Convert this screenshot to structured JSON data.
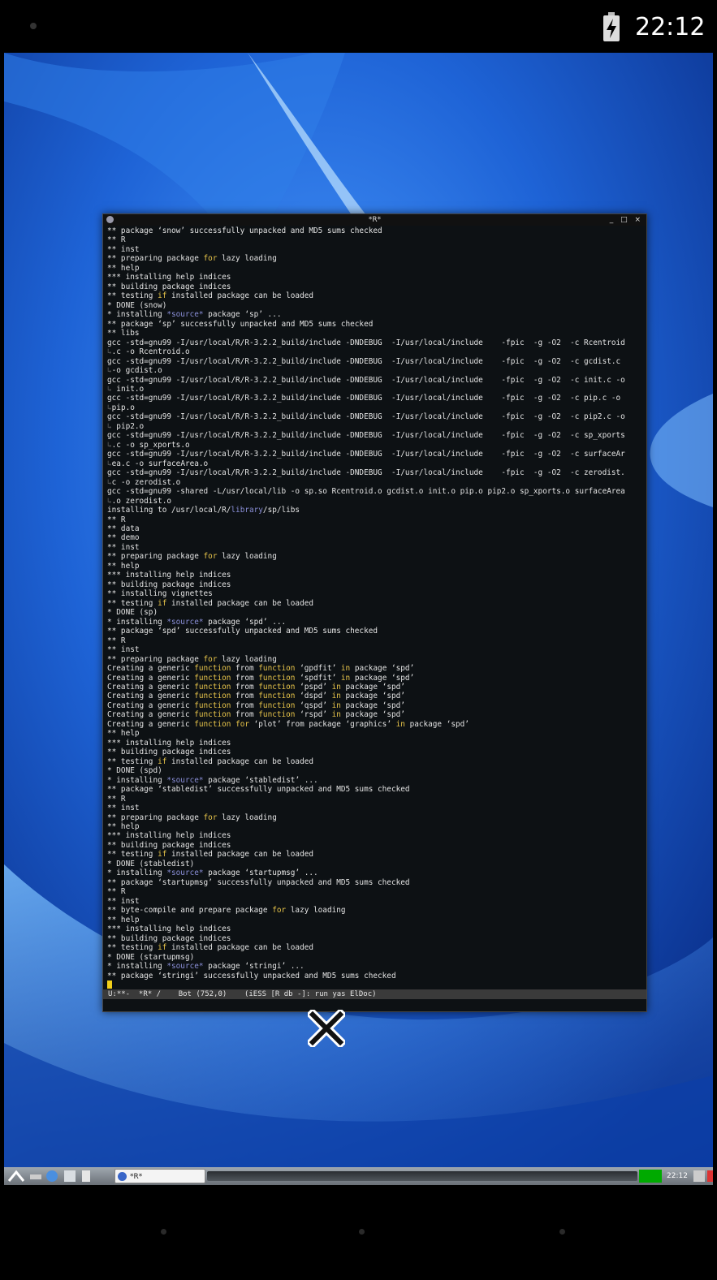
{
  "status_bar": {
    "time": "22:12"
  },
  "window": {
    "title": "*R*",
    "controls": "_ □ ×",
    "lines": [
      [
        {
          "t": "** package ‘snow’ successfully unpacked and MD5 sums checked"
        }
      ],
      [
        {
          "t": "** R"
        }
      ],
      [
        {
          "t": "** inst"
        }
      ],
      [
        {
          "t": "** preparing package "
        },
        {
          "t": "for",
          "c": "kw"
        },
        {
          "t": " lazy loading"
        }
      ],
      [
        {
          "t": "** help"
        }
      ],
      [
        {
          "t": "*** installing help indices"
        }
      ],
      [
        {
          "t": "** building package indices"
        }
      ],
      [
        {
          "t": "** testing "
        },
        {
          "t": "if",
          "c": "kw"
        },
        {
          "t": " installed package can be loaded"
        }
      ],
      [
        {
          "t": "* DONE (snow)"
        }
      ],
      [
        {
          "t": "* installing "
        },
        {
          "t": "*source*",
          "c": "ty"
        },
        {
          "t": " package ‘sp’ ..."
        }
      ],
      [
        {
          "t": "** package ‘sp’ successfully unpacked and MD5 sums checked"
        }
      ],
      [
        {
          "t": "** libs"
        }
      ],
      [
        {
          "t": "gcc -std=gnu99 -I/usr/local/R/R-3.2.2_build/include -DNDEBUG  -I/usr/local/include    -fpic  -g -O2  -c Rcentroid"
        }
      ],
      [
        {
          "t": "↳",
          "c": "cont"
        },
        {
          "t": ".c -o Rcentroid.o"
        }
      ],
      [
        {
          "t": "gcc -std=gnu99 -I/usr/local/R/R-3.2.2_build/include -DNDEBUG  -I/usr/local/include    -fpic  -g -O2  -c gcdist.c"
        }
      ],
      [
        {
          "t": "↳",
          "c": "cont"
        },
        {
          "t": "-o gcdist.o"
        }
      ],
      [
        {
          "t": "gcc -std=gnu99 -I/usr/local/R/R-3.2.2_build/include -DNDEBUG  -I/usr/local/include    -fpic  -g -O2  -c init.c -o"
        }
      ],
      [
        {
          "t": "↳",
          "c": "cont"
        },
        {
          "t": " init.o"
        }
      ],
      [
        {
          "t": "gcc -std=gnu99 -I/usr/local/R/R-3.2.2_build/include -DNDEBUG  -I/usr/local/include    -fpic  -g -O2  -c pip.c -o"
        }
      ],
      [
        {
          "t": "↳",
          "c": "cont"
        },
        {
          "t": "pip.o"
        }
      ],
      [
        {
          "t": "gcc -std=gnu99 -I/usr/local/R/R-3.2.2_build/include -DNDEBUG  -I/usr/local/include    -fpic  -g -O2  -c pip2.c -o"
        }
      ],
      [
        {
          "t": "↳",
          "c": "cont"
        },
        {
          "t": " pip2.o"
        }
      ],
      [
        {
          "t": "gcc -std=gnu99 -I/usr/local/R/R-3.2.2_build/include -DNDEBUG  -I/usr/local/include    -fpic  -g -O2  -c sp_xports"
        }
      ],
      [
        {
          "t": "↳",
          "c": "cont"
        },
        {
          "t": ".c -o sp_xports.o"
        }
      ],
      [
        {
          "t": "gcc -std=gnu99 -I/usr/local/R/R-3.2.2_build/include -DNDEBUG  -I/usr/local/include    -fpic  -g -O2  -c surfaceAr"
        }
      ],
      [
        {
          "t": "↳",
          "c": "cont"
        },
        {
          "t": "ea.c -o surfaceArea.o"
        }
      ],
      [
        {
          "t": "gcc -std=gnu99 -I/usr/local/R/R-3.2.2_build/include -DNDEBUG  -I/usr/local/include    -fpic  -g -O2  -c zerodist."
        }
      ],
      [
        {
          "t": "↳",
          "c": "cont"
        },
        {
          "t": "c -o zerodist.o"
        }
      ],
      [
        {
          "t": "gcc -std=gnu99 -shared -L/usr/local/lib -o sp.so Rcentroid.o gcdist.o init.o pip.o pip2.o sp_xports.o surfaceArea"
        }
      ],
      [
        {
          "t": "↳",
          "c": "cont"
        },
        {
          "t": ".o zerodist.o"
        }
      ],
      [
        {
          "t": "installing to /usr/local/R/"
        },
        {
          "t": "library",
          "c": "ty"
        },
        {
          "t": "/sp/libs"
        }
      ],
      [
        {
          "t": "** R"
        }
      ],
      [
        {
          "t": "** data"
        }
      ],
      [
        {
          "t": "** demo"
        }
      ],
      [
        {
          "t": "** inst"
        }
      ],
      [
        {
          "t": "** preparing package "
        },
        {
          "t": "for",
          "c": "kw"
        },
        {
          "t": " lazy loading"
        }
      ],
      [
        {
          "t": "** help"
        }
      ],
      [
        {
          "t": "*** installing help indices"
        }
      ],
      [
        {
          "t": "** building package indices"
        }
      ],
      [
        {
          "t": "** installing vignettes"
        }
      ],
      [
        {
          "t": "** testing "
        },
        {
          "t": "if",
          "c": "kw"
        },
        {
          "t": " installed package can be loaded"
        }
      ],
      [
        {
          "t": "* DONE (sp)"
        }
      ],
      [
        {
          "t": "* installing "
        },
        {
          "t": "*source*",
          "c": "ty"
        },
        {
          "t": " package ‘spd’ ..."
        }
      ],
      [
        {
          "t": "** package ‘spd’ successfully unpacked and MD5 sums checked"
        }
      ],
      [
        {
          "t": "** R"
        }
      ],
      [
        {
          "t": "** inst"
        }
      ],
      [
        {
          "t": "** preparing package "
        },
        {
          "t": "for",
          "c": "kw"
        },
        {
          "t": " lazy loading"
        }
      ],
      [
        {
          "t": "Creating a generic "
        },
        {
          "t": "function",
          "c": "kw"
        },
        {
          "t": " from "
        },
        {
          "t": "function",
          "c": "kw"
        },
        {
          "t": " ‘gpdfit’ "
        },
        {
          "t": "in",
          "c": "kw"
        },
        {
          "t": " package ‘spd’"
        }
      ],
      [
        {
          "t": "Creating a generic "
        },
        {
          "t": "function",
          "c": "kw"
        },
        {
          "t": " from "
        },
        {
          "t": "function",
          "c": "kw"
        },
        {
          "t": " ‘spdfit’ "
        },
        {
          "t": "in",
          "c": "kw"
        },
        {
          "t": " package ‘spd’"
        }
      ],
      [
        {
          "t": "Creating a generic "
        },
        {
          "t": "function",
          "c": "kw"
        },
        {
          "t": " from "
        },
        {
          "t": "function",
          "c": "kw"
        },
        {
          "t": " ‘pspd’ "
        },
        {
          "t": "in",
          "c": "kw"
        },
        {
          "t": " package ‘spd’"
        }
      ],
      [
        {
          "t": "Creating a generic "
        },
        {
          "t": "function",
          "c": "kw"
        },
        {
          "t": " from "
        },
        {
          "t": "function",
          "c": "kw"
        },
        {
          "t": " ‘dspd’ "
        },
        {
          "t": "in",
          "c": "kw"
        },
        {
          "t": " package ‘spd’"
        }
      ],
      [
        {
          "t": "Creating a generic "
        },
        {
          "t": "function",
          "c": "kw"
        },
        {
          "t": " from "
        },
        {
          "t": "function",
          "c": "kw"
        },
        {
          "t": " ‘qspd’ "
        },
        {
          "t": "in",
          "c": "kw"
        },
        {
          "t": " package ‘spd’"
        }
      ],
      [
        {
          "t": "Creating a generic "
        },
        {
          "t": "function",
          "c": "kw"
        },
        {
          "t": " from "
        },
        {
          "t": "function",
          "c": "kw"
        },
        {
          "t": " ‘rspd’ "
        },
        {
          "t": "in",
          "c": "kw"
        },
        {
          "t": " package ‘spd’"
        }
      ],
      [
        {
          "t": "Creating a generic "
        },
        {
          "t": "function",
          "c": "kw"
        },
        {
          "t": " "
        },
        {
          "t": "for",
          "c": "kw"
        },
        {
          "t": " ‘plot’ from package ‘graphics’ "
        },
        {
          "t": "in",
          "c": "kw"
        },
        {
          "t": " package ‘spd’"
        }
      ],
      [
        {
          "t": "** help"
        }
      ],
      [
        {
          "t": "*** installing help indices"
        }
      ],
      [
        {
          "t": "** building package indices"
        }
      ],
      [
        {
          "t": "** testing "
        },
        {
          "t": "if",
          "c": "kw"
        },
        {
          "t": " installed package can be loaded"
        }
      ],
      [
        {
          "t": "* DONE (spd)"
        }
      ],
      [
        {
          "t": "* installing "
        },
        {
          "t": "*source*",
          "c": "ty"
        },
        {
          "t": " package ‘stabledist’ ..."
        }
      ],
      [
        {
          "t": "** package ‘stabledist’ successfully unpacked and MD5 sums checked"
        }
      ],
      [
        {
          "t": "** R"
        }
      ],
      [
        {
          "t": "** inst"
        }
      ],
      [
        {
          "t": "** preparing package "
        },
        {
          "t": "for",
          "c": "kw"
        },
        {
          "t": " lazy loading"
        }
      ],
      [
        {
          "t": "** help"
        }
      ],
      [
        {
          "t": "*** installing help indices"
        }
      ],
      [
        {
          "t": "** building package indices"
        }
      ],
      [
        {
          "t": "** testing "
        },
        {
          "t": "if",
          "c": "kw"
        },
        {
          "t": " installed package can be loaded"
        }
      ],
      [
        {
          "t": "* DONE (stabledist)"
        }
      ],
      [
        {
          "t": "* installing "
        },
        {
          "t": "*source*",
          "c": "ty"
        },
        {
          "t": " package ‘startupmsg’ ..."
        }
      ],
      [
        {
          "t": "** package ‘startupmsg’ successfully unpacked and MD5 sums checked"
        }
      ],
      [
        {
          "t": "** R"
        }
      ],
      [
        {
          "t": "** inst"
        }
      ],
      [
        {
          "t": "** byte-compile and prepare package "
        },
        {
          "t": "for",
          "c": "kw"
        },
        {
          "t": " lazy loading"
        }
      ],
      [
        {
          "t": "** help"
        }
      ],
      [
        {
          "t": "*** installing help indices"
        }
      ],
      [
        {
          "t": "** building package indices"
        }
      ],
      [
        {
          "t": "** testing "
        },
        {
          "t": "if",
          "c": "kw"
        },
        {
          "t": " installed package can be loaded"
        }
      ],
      [
        {
          "t": "* DONE (startupmsg)"
        }
      ],
      [
        {
          "t": "* installing "
        },
        {
          "t": "*source*",
          "c": "ty"
        },
        {
          "t": " package ‘stringi’ ..."
        }
      ],
      [
        {
          "t": "** package ‘stringi’ successfully unpacked and MD5 sums checked"
        }
      ]
    ],
    "modeline": "U:**-  *R* /    Bot (752,0)    (iESS [R db -]: run yas ElDoc)"
  },
  "taskbar": {
    "task_label": "*R*",
    "clock": "22:12"
  },
  "colors": {
    "keyword": "#e8c54a",
    "type": "#8a8fd8",
    "cursor": "#f2cf1a",
    "wallpaper": "#1a56c8"
  }
}
